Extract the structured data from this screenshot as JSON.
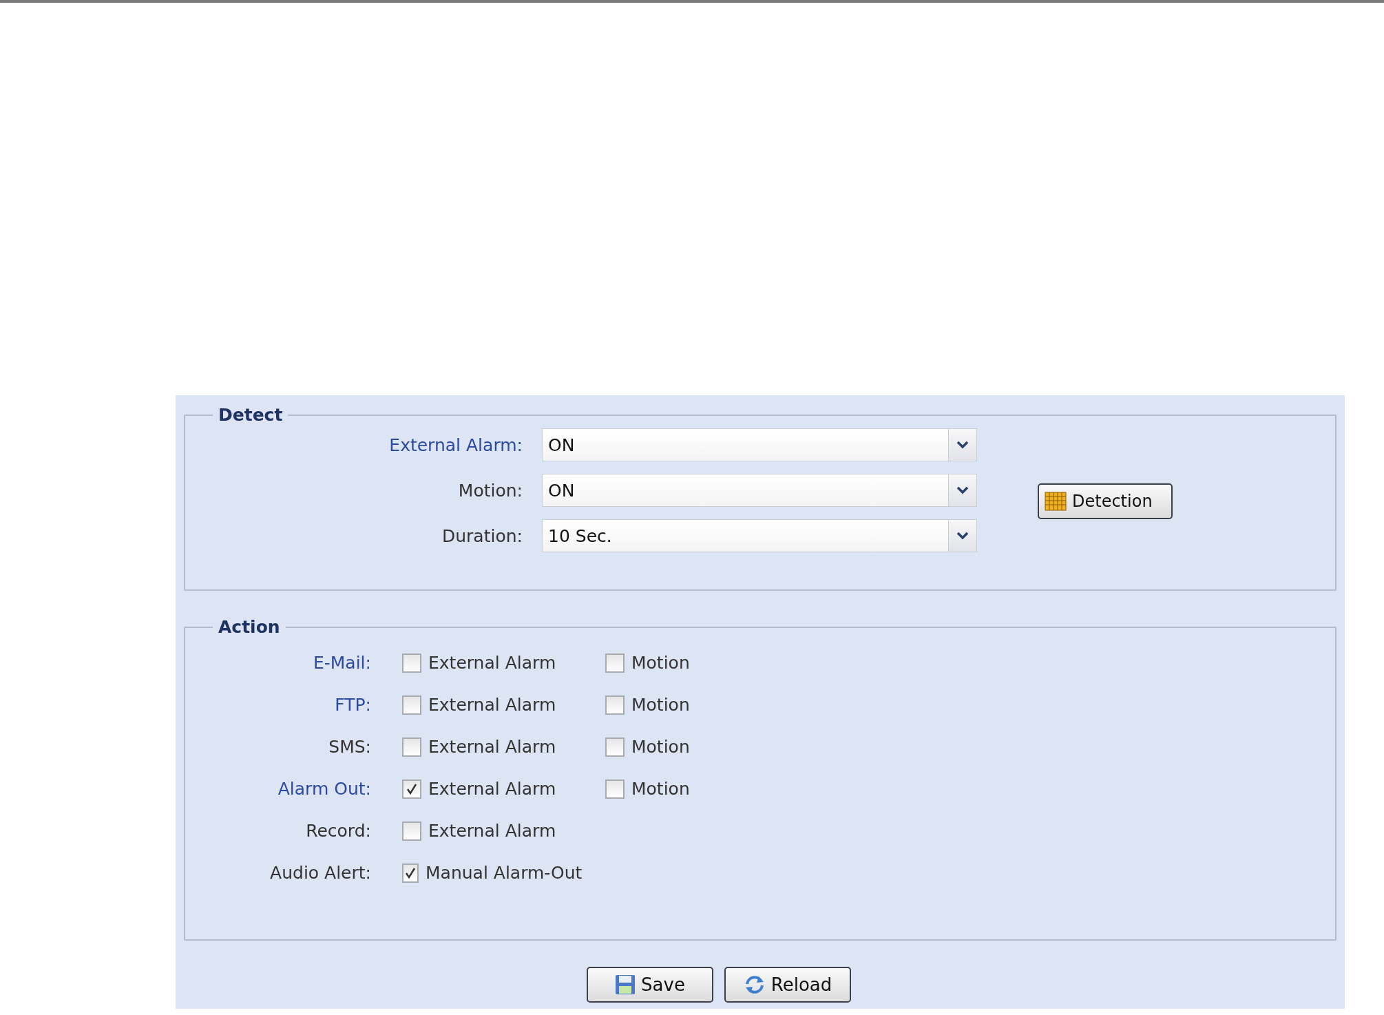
{
  "detect": {
    "legend": "Detect",
    "fields": [
      {
        "label": "External Alarm:",
        "link": true,
        "value": "ON"
      },
      {
        "label": "Motion:",
        "link": false,
        "value": "ON"
      },
      {
        "label": "Duration:",
        "link": false,
        "value": "10 Sec."
      }
    ],
    "detection_button": "Detection"
  },
  "action": {
    "legend": "Action",
    "rows": [
      {
        "label": "E-Mail:",
        "link": true,
        "options": [
          {
            "label": "External Alarm",
            "checked": false
          },
          {
            "label": "Motion",
            "checked": false
          }
        ]
      },
      {
        "label": "FTP:",
        "link": true,
        "options": [
          {
            "label": "External Alarm",
            "checked": false
          },
          {
            "label": "Motion",
            "checked": false
          }
        ]
      },
      {
        "label": "SMS:",
        "link": false,
        "options": [
          {
            "label": "External Alarm",
            "checked": false
          },
          {
            "label": "Motion",
            "checked": false
          }
        ]
      },
      {
        "label": "Alarm Out:",
        "link": true,
        "options": [
          {
            "label": "External Alarm",
            "checked": true
          },
          {
            "label": "Motion",
            "checked": false
          }
        ]
      },
      {
        "label": "Record:",
        "link": false,
        "options": [
          {
            "label": "External Alarm",
            "checked": false
          }
        ]
      },
      {
        "label": "Audio Alert:",
        "link": false,
        "options": [
          {
            "label": "Manual Alarm-Out",
            "checked": true
          }
        ]
      }
    ]
  },
  "buttons": [
    {
      "kind": "save",
      "label": "Save"
    },
    {
      "kind": "reload",
      "label": "Reload"
    }
  ]
}
